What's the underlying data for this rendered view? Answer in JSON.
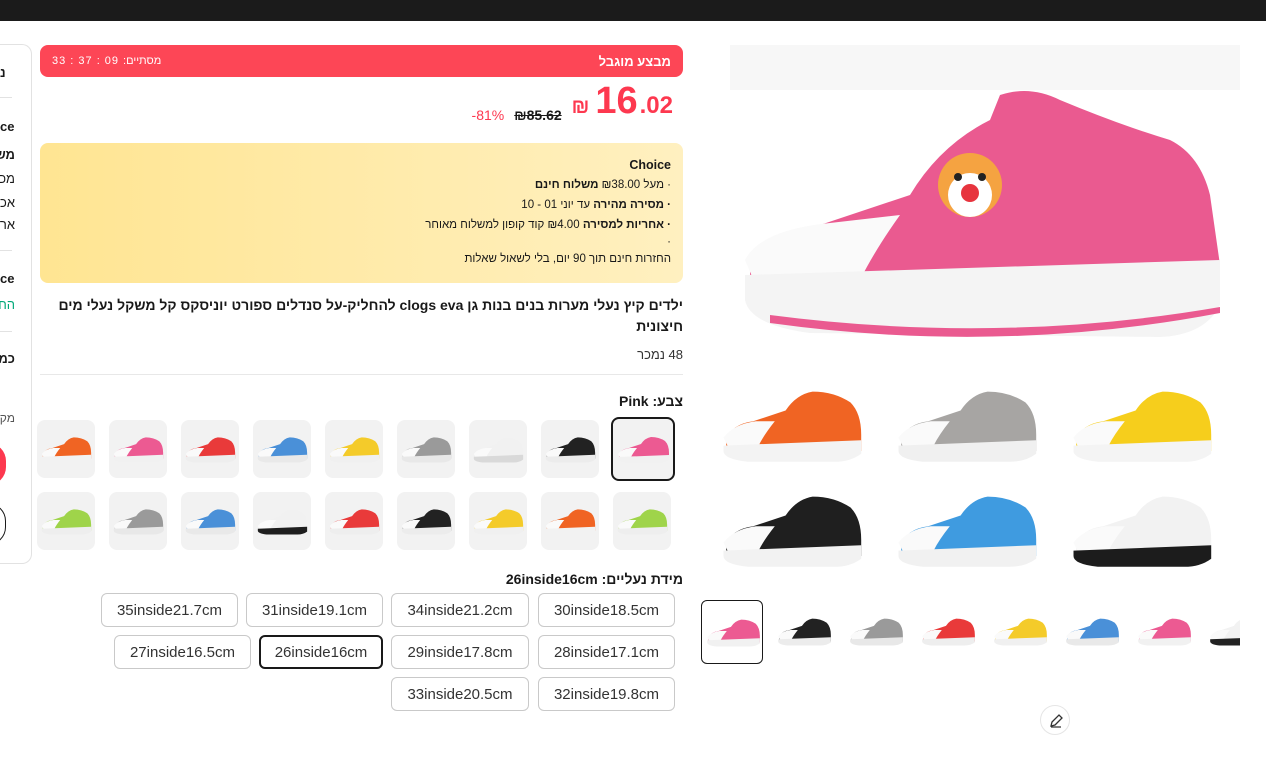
{
  "deal": {
    "title": "מבצע מוגבל",
    "ends_label": "מסתיים:",
    "timer": "33 : 37 : 09"
  },
  "price": {
    "currency": "₪",
    "integer": "16",
    "decimal": ".02",
    "old": "₪85.62",
    "discount": "-81%"
  },
  "choice": {
    "title": "Choice",
    "line1_pre": "· מעל ₪38.00 ",
    "line1_bold": "משלוח חינם",
    "line2_bold": "· מסירה מהירה",
    "line2_post": " עד יוני 01 - 10",
    "line3_bold": "· אחריות למסירה",
    "line3_post": " ₪4.00 קוד קופון למשלוח מאוחר",
    "line4": "·",
    "line5": "החזרות חינם תוך 90 יום, בלי לשאול שאלות"
  },
  "product_title": "ילדים קיץ נעלי מערות בנים בנות גן clogs eva להחליק-על סנדלים ספורט יוניסקס קל משקל נעלי מים חיצונית",
  "sold": "48 נמכר",
  "color": {
    "label": "צבע:",
    "value": "Pink"
  },
  "size": {
    "label": "מידת נעליים:",
    "value": "26inside16cm",
    "options": [
      "30inside18.5cm",
      "34inside21.2cm",
      "31inside19.1cm",
      "35inside21.7cm",
      "28inside17.1cm",
      "29inside17.8cm",
      "26inside16cm",
      "27inside16.5cm",
      "32inside19.8cm",
      "33inside20.5cm"
    ],
    "selected": "26inside16cm"
  },
  "swatch_colors": [
    {
      "name": "pink",
      "body": "#ec5a92",
      "sole": "#f1f1f1",
      "selected": true
    },
    {
      "name": "black",
      "body": "#222222",
      "sole": "#ececec"
    },
    {
      "name": "white",
      "body": "#f1f1f1",
      "sole": "#d9d9d9"
    },
    {
      "name": "grey",
      "body": "#9a9a9a",
      "sole": "#e8e8e8"
    },
    {
      "name": "yellow",
      "body": "#f4cb2a",
      "sole": "#f0f0f0"
    },
    {
      "name": "blue",
      "body": "#4a90d8",
      "sole": "#e9e9e9"
    },
    {
      "name": "red",
      "body": "#e93a3a",
      "sole": "#eeeeee"
    },
    {
      "name": "pink2",
      "body": "#ec5a92",
      "sole": "#f1f1f1"
    },
    {
      "name": "orange",
      "body": "#f06423",
      "sole": "#f2f2f2"
    },
    {
      "name": "lime",
      "body": "#9fd44a",
      "sole": "#eeeeee"
    },
    {
      "name": "orange2",
      "body": "#f06423",
      "sole": "#f2f2f2"
    },
    {
      "name": "yellow2",
      "body": "#f4cb2a",
      "sole": "#f0f0f0"
    },
    {
      "name": "black2",
      "body": "#222222",
      "sole": "#ececec"
    },
    {
      "name": "red2",
      "body": "#e93a3a",
      "sole": "#eeeeee"
    },
    {
      "name": "white-black",
      "body": "#f1f1f1",
      "sole": "#1e1e1e"
    },
    {
      "name": "blue2",
      "body": "#4a90d8",
      "sole": "#e9e9e9"
    },
    {
      "name": "grey2",
      "body": "#9a9a9a",
      "sole": "#e8e8e8"
    },
    {
      "name": "lime2",
      "body": "#9fd44a",
      "sole": "#eeeeee"
    }
  ],
  "gallery_grid": [
    {
      "body": "#f06423",
      "sole": "#f3f3f3"
    },
    {
      "body": "#a7a5a3",
      "sole": "#f0f0f0"
    },
    {
      "body": "#f6ce1c",
      "sole": "#f4f4f4"
    },
    {
      "body": "#1f1f1f",
      "sole": "#f2f2f2"
    },
    {
      "body": "#3f9be0",
      "sole": "#f1f1f1"
    },
    {
      "body": "#f2f2f2",
      "sole": "#1c1c1c"
    }
  ],
  "thumbs": [
    {
      "body": "#ec5a92",
      "sole": "#f1f1f1",
      "active": true
    },
    {
      "body": "#222222",
      "sole": "#ececec"
    },
    {
      "body": "#9a9a9a",
      "sole": "#e8e8e8"
    },
    {
      "body": "#e93a3a",
      "sole": "#eeeeee"
    },
    {
      "body": "#f4cb2a",
      "sole": "#f0f0f0"
    },
    {
      "body": "#4a90d8",
      "sole": "#e9e9e9"
    },
    {
      "body": "#ec5a92",
      "sole": "#f1f1f1"
    },
    {
      "body": "#f2f2f2",
      "sole": "#222222"
    }
  ],
  "side_panel": {
    "frag1": "נ",
    "frag2": "ce",
    "frag3": "מש",
    "frag4": "מכ",
    "frag5": "אכ",
    "frag6": "אר",
    "frag7": "ce",
    "frag8": "הח",
    "frag9": "כמ",
    "frag10": "מק"
  },
  "colors": {
    "accent": "#fd384f",
    "deal": "#fd4656",
    "choice_bg": "#ffe592"
  }
}
